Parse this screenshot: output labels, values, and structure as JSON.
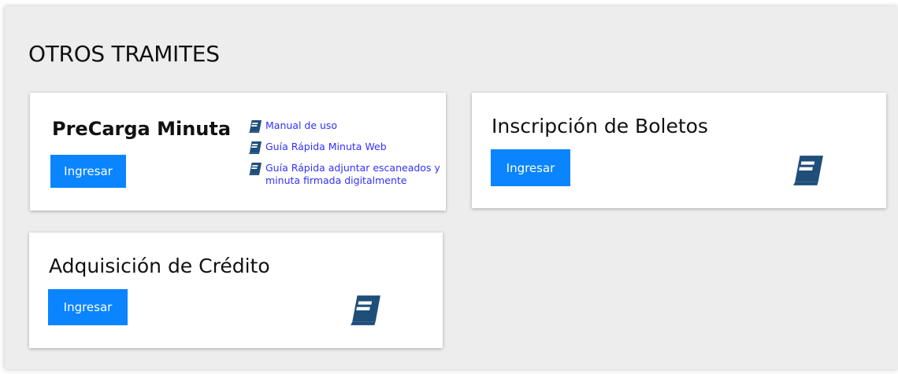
{
  "section": {
    "title": "OTROS TRAMITES"
  },
  "colors": {
    "button": "#0a84ff",
    "link": "#3131ff",
    "icon": "#1f4e7a",
    "panel": "#ededed"
  },
  "cards": [
    {
      "title": "PreCarga Minuta",
      "button": "Ingresar",
      "links": [
        {
          "icon": "book-icon",
          "text": "Manual de uso"
        },
        {
          "icon": "book-icon",
          "text": "Guía Rápida Minuta Web"
        },
        {
          "icon": "book-icon",
          "text": "Guía Rápida adjuntar escaneados y minuta firmada digitalmente"
        }
      ]
    },
    {
      "title": "Inscripción de Boletos",
      "button": "Ingresar",
      "icon": "book-icon"
    },
    {
      "title": "Adquisición de Crédito",
      "button": "Ingresar",
      "icon": "book-icon"
    }
  ]
}
